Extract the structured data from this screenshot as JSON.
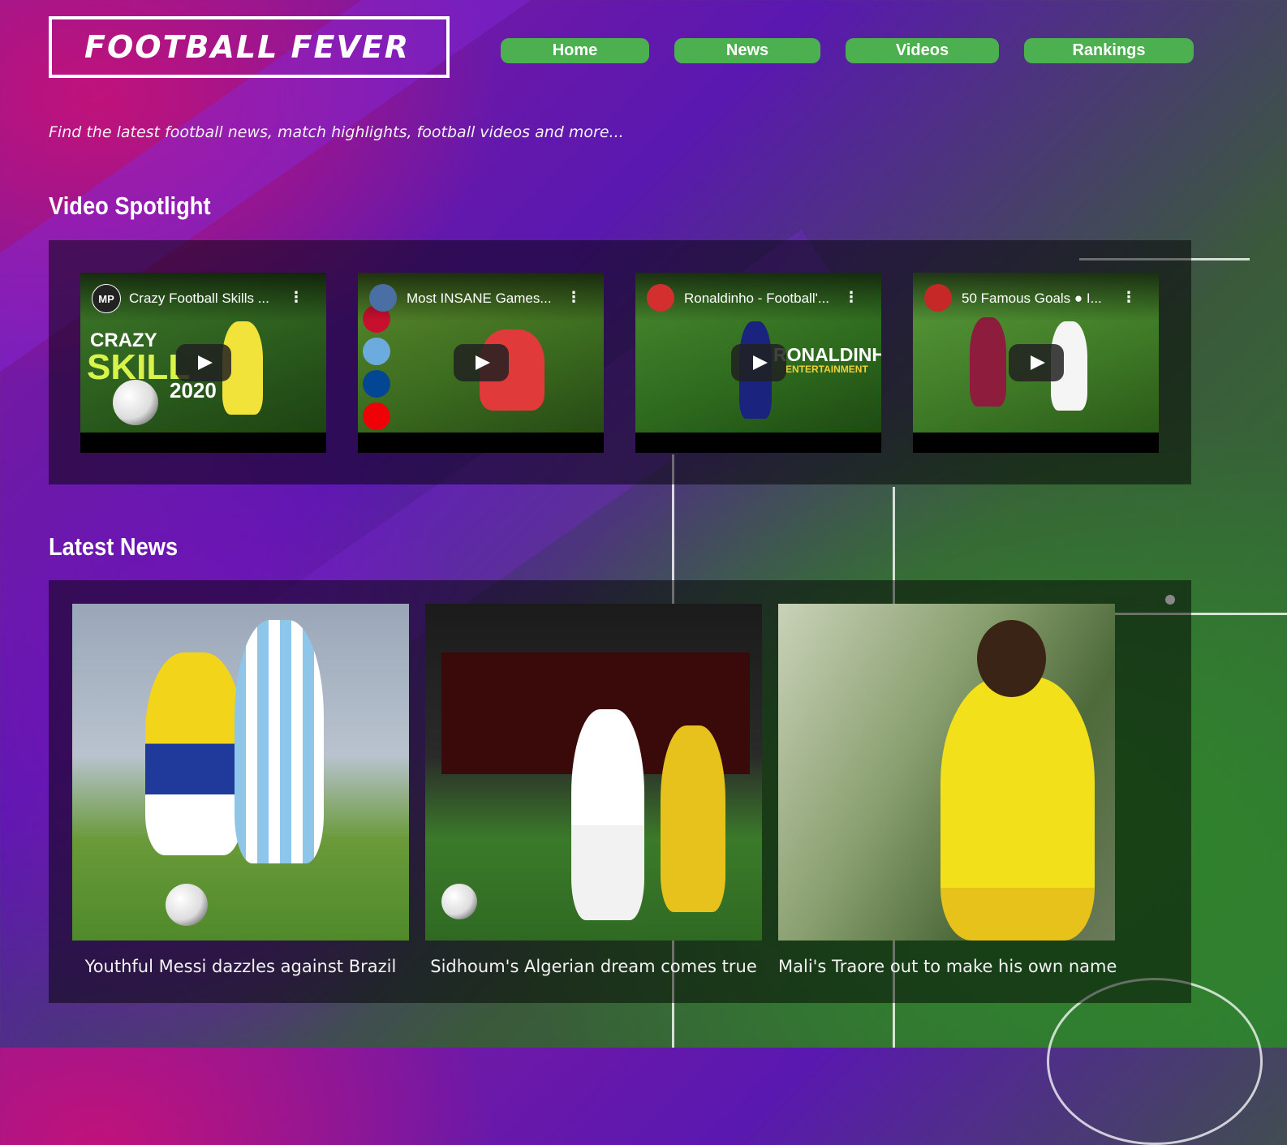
{
  "site": {
    "logo": "FOOTBALL FEVER",
    "tagline": "Find the latest football news, match highlights, football videos and more..."
  },
  "nav": {
    "items": [
      {
        "label": "Home"
      },
      {
        "label": "News"
      },
      {
        "label": "Videos"
      },
      {
        "label": "Rankings"
      }
    ],
    "button_color": "#4caf50"
  },
  "video_spotlight": {
    "title": "Video Spotlight",
    "videos": [
      {
        "title": "Crazy Football Skills ...",
        "channel_badge": "MP",
        "thumb_line1": "CRAZY",
        "thumb_line2": "SKILL",
        "thumb_line3": "2020"
      },
      {
        "title": "Most INSANE Games...",
        "channel_badge": ""
      },
      {
        "title": "Ronaldinho - Football'...",
        "channel_badge": "",
        "thumb_line1": "RONALDINHO",
        "thumb_line2": "ENTERTAINMENT"
      },
      {
        "title": "50 Famous Goals ● I...",
        "channel_badge": ""
      }
    ],
    "icons": {
      "play": "play-icon",
      "more": "more-vert-icon"
    }
  },
  "latest_news": {
    "title": "Latest News",
    "articles": [
      {
        "caption": "Youthful Messi dazzles against Brazil"
      },
      {
        "caption": "Sidhoum's Algerian dream comes true"
      },
      {
        "caption": "Mali's Traore out to make his own name"
      }
    ]
  }
}
